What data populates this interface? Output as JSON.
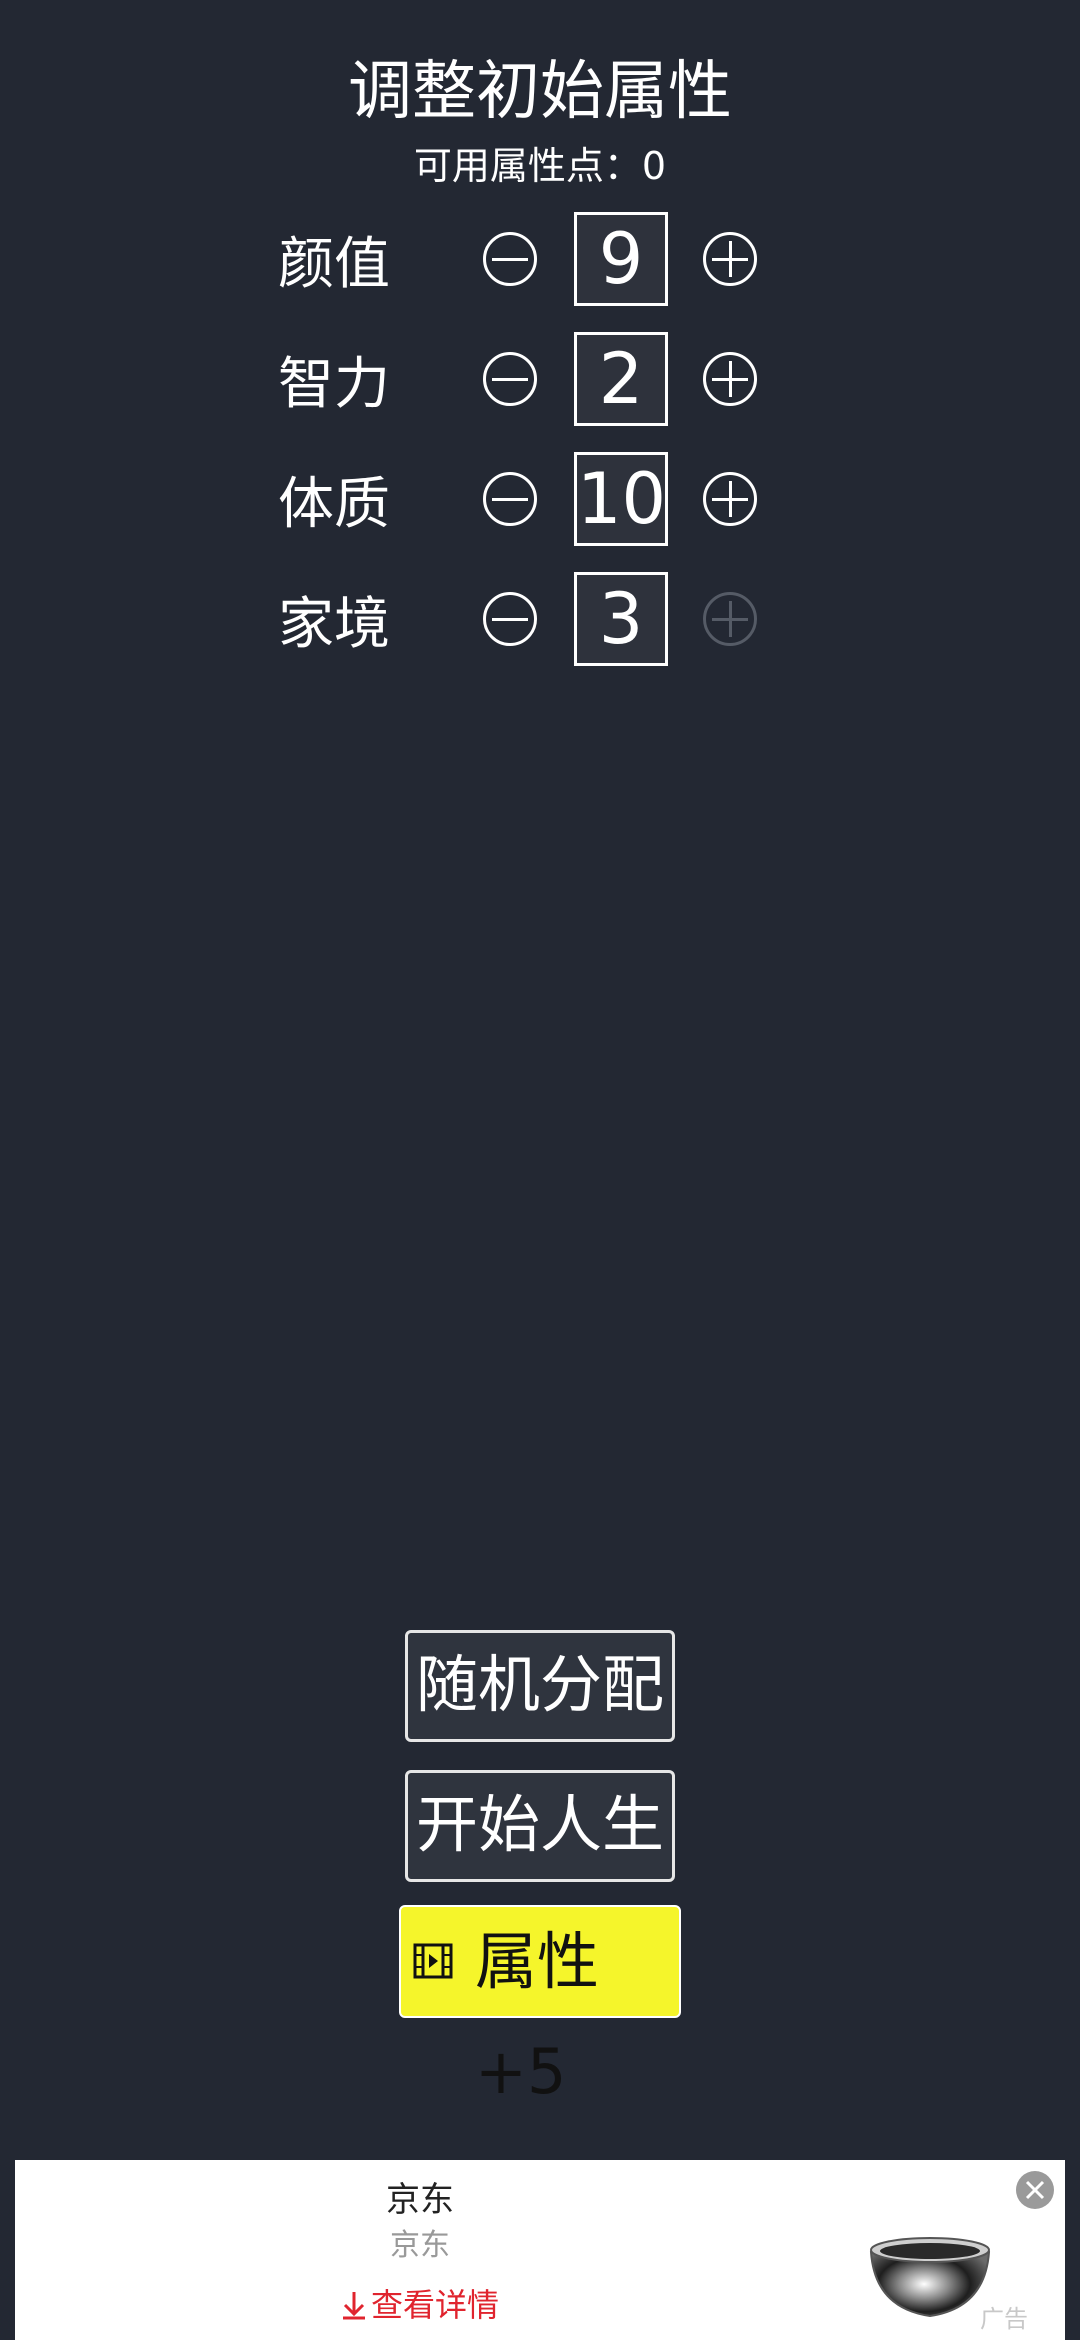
{
  "header": {
    "title": "调整初始属性",
    "points_label": "可用属性点：0"
  },
  "stats": [
    {
      "label": "颜值",
      "value": "9",
      "plus_enabled": true
    },
    {
      "label": "智力",
      "value": "2",
      "plus_enabled": true
    },
    {
      "label": "体质",
      "value": "10",
      "plus_enabled": true
    },
    {
      "label": "家境",
      "value": "3",
      "plus_enabled": false
    }
  ],
  "buttons": {
    "random": "随机分配",
    "start": "开始人生",
    "bonus": "属性+5"
  },
  "ad": {
    "title": "京东",
    "subtitle": "京东",
    "cta": "查看详情",
    "badge": "广告"
  },
  "colors": {
    "background": "#232833",
    "bonus_button": "#f5f52b",
    "ad_cta": "#e0242e"
  },
  "icons": {
    "minus": "minus-circle-icon",
    "plus": "plus-circle-icon",
    "bonus": "video-icon",
    "cta": "download-arrow-icon",
    "close": "close-icon"
  }
}
